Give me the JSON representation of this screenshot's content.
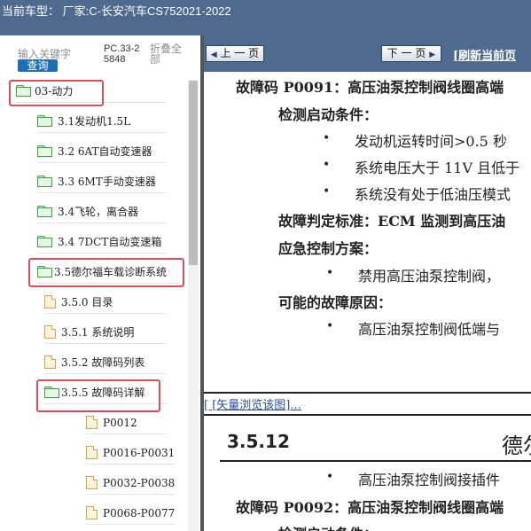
{
  "header": {
    "title": "当前车型：  厂家:C-长安汽车CS752021-2022"
  },
  "sidebar": {
    "search_label": "输入关键字",
    "search_button": "查询",
    "pc_code": "PC.33-25848",
    "collapse_label": "折叠全部",
    "tree": [
      {
        "label": "03-动力",
        "icon": "folder-open-icon"
      },
      {
        "label": "3.1发动机1.5L",
        "icon": "folder-icon"
      },
      {
        "label": "3.2 6AT自动变速器",
        "icon": "folder-icon"
      },
      {
        "label": "3.3 6MT手动变速器",
        "icon": "folder-icon"
      },
      {
        "label": "3.4飞轮，离合器",
        "icon": "folder-icon"
      },
      {
        "label": "3.4 7DCT自动变速箱",
        "icon": "folder-icon"
      },
      {
        "label": "3.5德尔福车载诊断系统",
        "icon": "folder-open-icon"
      },
      {
        "label": "3.5.0 目录",
        "icon": "document-icon"
      },
      {
        "label": "3.5.1 系统说明",
        "icon": "document-icon"
      },
      {
        "label": "3.5.2 故障码列表",
        "icon": "document-icon"
      },
      {
        "label": "3.5.5 故障码详解",
        "icon": "folder-open-icon"
      },
      {
        "label": "P0012",
        "icon": "document-icon"
      },
      {
        "label": "P0016-P0031",
        "icon": "document-icon"
      },
      {
        "label": "P0032-P0038",
        "icon": "document-icon"
      },
      {
        "label": "P0068-P0077",
        "icon": "document-icon"
      }
    ]
  },
  "nav": {
    "prev_label": "上 一 页",
    "next_label": "下 一 页",
    "refresh_label": "[刷新当前页"
  },
  "document": {
    "dtc1_heading": "故障码  P0091：高压油泵控制阀线圈高端",
    "detect_label": "检测启动条件：",
    "detect_items": [
      "发动机运转时间>0.5 秒",
      "系统电压大于 11V 且低于",
      "系统没有处于低油压模式"
    ],
    "criteria": "故障判定标准：ECM 监测到高压油",
    "emergency_label": "应急控制方案：",
    "emergency_items": [
      "禁用高压油泵控制阀，"
    ],
    "causes_label": "可能的故障原因：",
    "causes_items": [
      "高压油泵控制阀低端与"
    ]
  },
  "vector_link": "[ [矢量浏览该图]...",
  "lower": {
    "section_number": "3.5.12",
    "section_title": "德尔",
    "bullet_text": "高压油泵控制阀接插件",
    "dtc2_heading": "故障码  P0092：高压油泵控制阀线圈高端",
    "next_label": "检测启动条件："
  }
}
